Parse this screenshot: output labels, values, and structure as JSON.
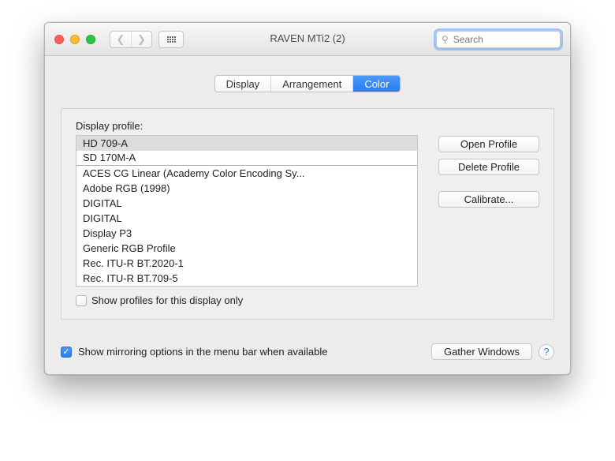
{
  "window": {
    "title": "RAVEN MTi2 (2)"
  },
  "search": {
    "placeholder": "Search",
    "value": ""
  },
  "tabs": [
    {
      "label": "Display",
      "selected": false
    },
    {
      "label": "Arrangement",
      "selected": false
    },
    {
      "label": "Color",
      "selected": true
    }
  ],
  "display_profile": {
    "label": "Display profile:",
    "items": [
      {
        "label": "HD 709-A",
        "selected": true,
        "group_sep": false
      },
      {
        "label": "SD 170M-A",
        "selected": false,
        "group_sep": true
      },
      {
        "label": "ACES CG Linear (Academy Color Encoding Sy...",
        "selected": false,
        "group_sep": false
      },
      {
        "label": "Adobe RGB (1998)",
        "selected": false,
        "group_sep": false
      },
      {
        "label": "DIGITAL",
        "selected": false,
        "group_sep": false
      },
      {
        "label": "DIGITAL",
        "selected": false,
        "group_sep": false
      },
      {
        "label": "Display P3",
        "selected": false,
        "group_sep": false
      },
      {
        "label": "Generic RGB Profile",
        "selected": false,
        "group_sep": false
      },
      {
        "label": "Rec. ITU-R BT.2020-1",
        "selected": false,
        "group_sep": false
      },
      {
        "label": "Rec. ITU-R BT.709-5",
        "selected": false,
        "group_sep": false
      }
    ]
  },
  "buttons": {
    "open_profile": "Open Profile",
    "delete_profile": "Delete Profile",
    "calibrate": "Calibrate...",
    "gather_windows": "Gather Windows"
  },
  "checkboxes": {
    "show_only_this_display": {
      "label": "Show profiles for this display only",
      "checked": false
    },
    "show_mirroring": {
      "label": "Show mirroring options in the menu bar when available",
      "checked": true
    }
  }
}
